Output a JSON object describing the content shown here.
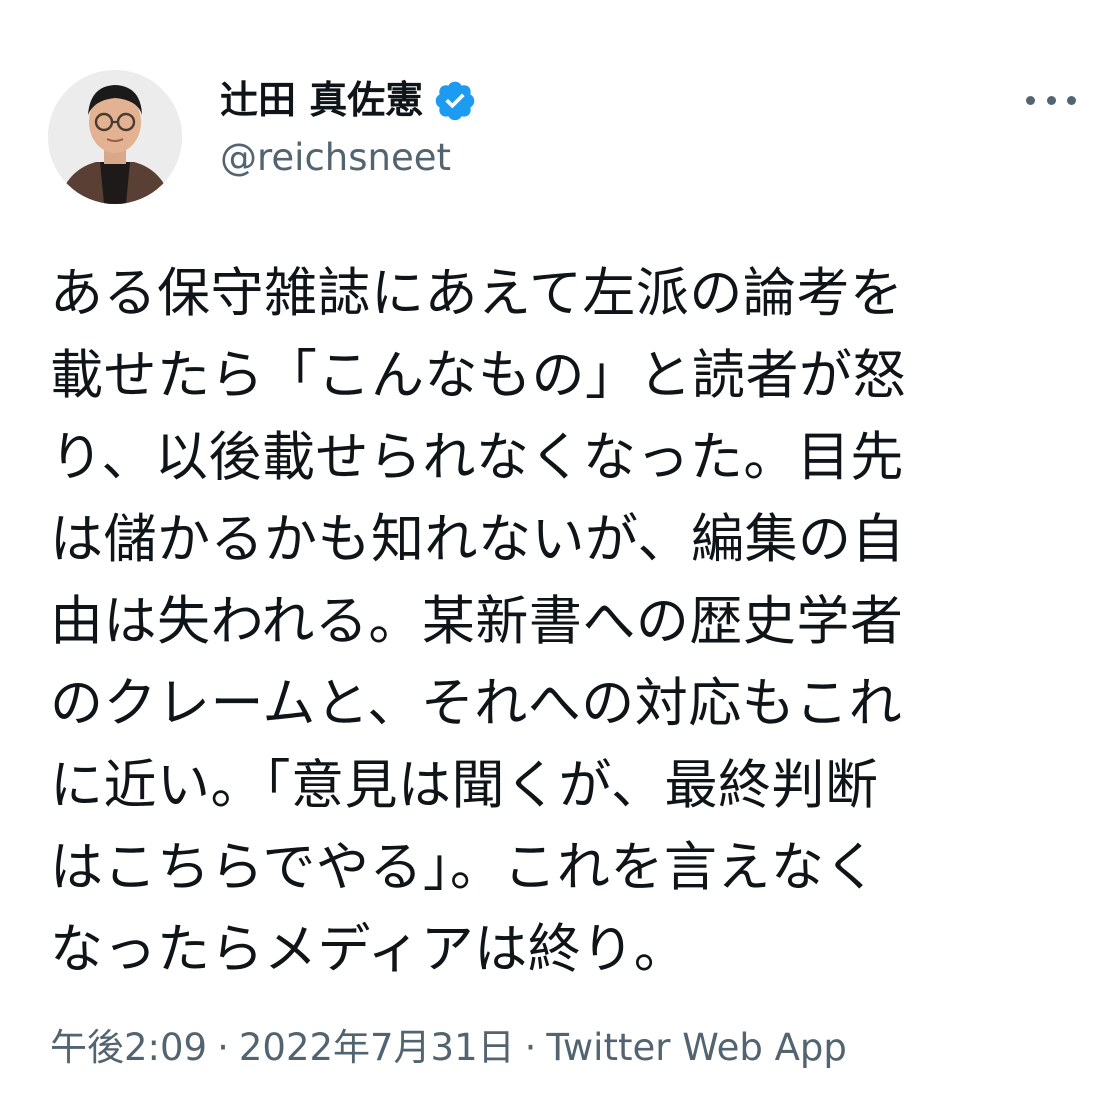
{
  "user": {
    "display_name": "辻田 真佐憲",
    "handle": "@reichsneet",
    "verified": true
  },
  "tweet": {
    "lines": [
      "ある保守雑誌にあえて左派の論考を",
      "載せたら「こんなもの」と読者が怒",
      "り、以後載せられなくなった。目先",
      "は儲かるかも知れないが、編集の自",
      "由は失われる。某新書への歴史学者",
      "のクレームと、それへの対応もこれ",
      "に近い。「意見は聞くが、最終判断",
      "はこちらでやる」。これを言えなく",
      "なったらメディアは終り。"
    ]
  },
  "meta": {
    "time": "午後2:09",
    "separator": "·",
    "date": "2022年7月31日",
    "source": "Twitter Web App"
  },
  "icons": {
    "verified": "verified-badge-icon",
    "more": "more-options-icon"
  },
  "colors": {
    "text": "#0f1419",
    "secondary": "#536471",
    "verified": "#1d9bf0"
  }
}
